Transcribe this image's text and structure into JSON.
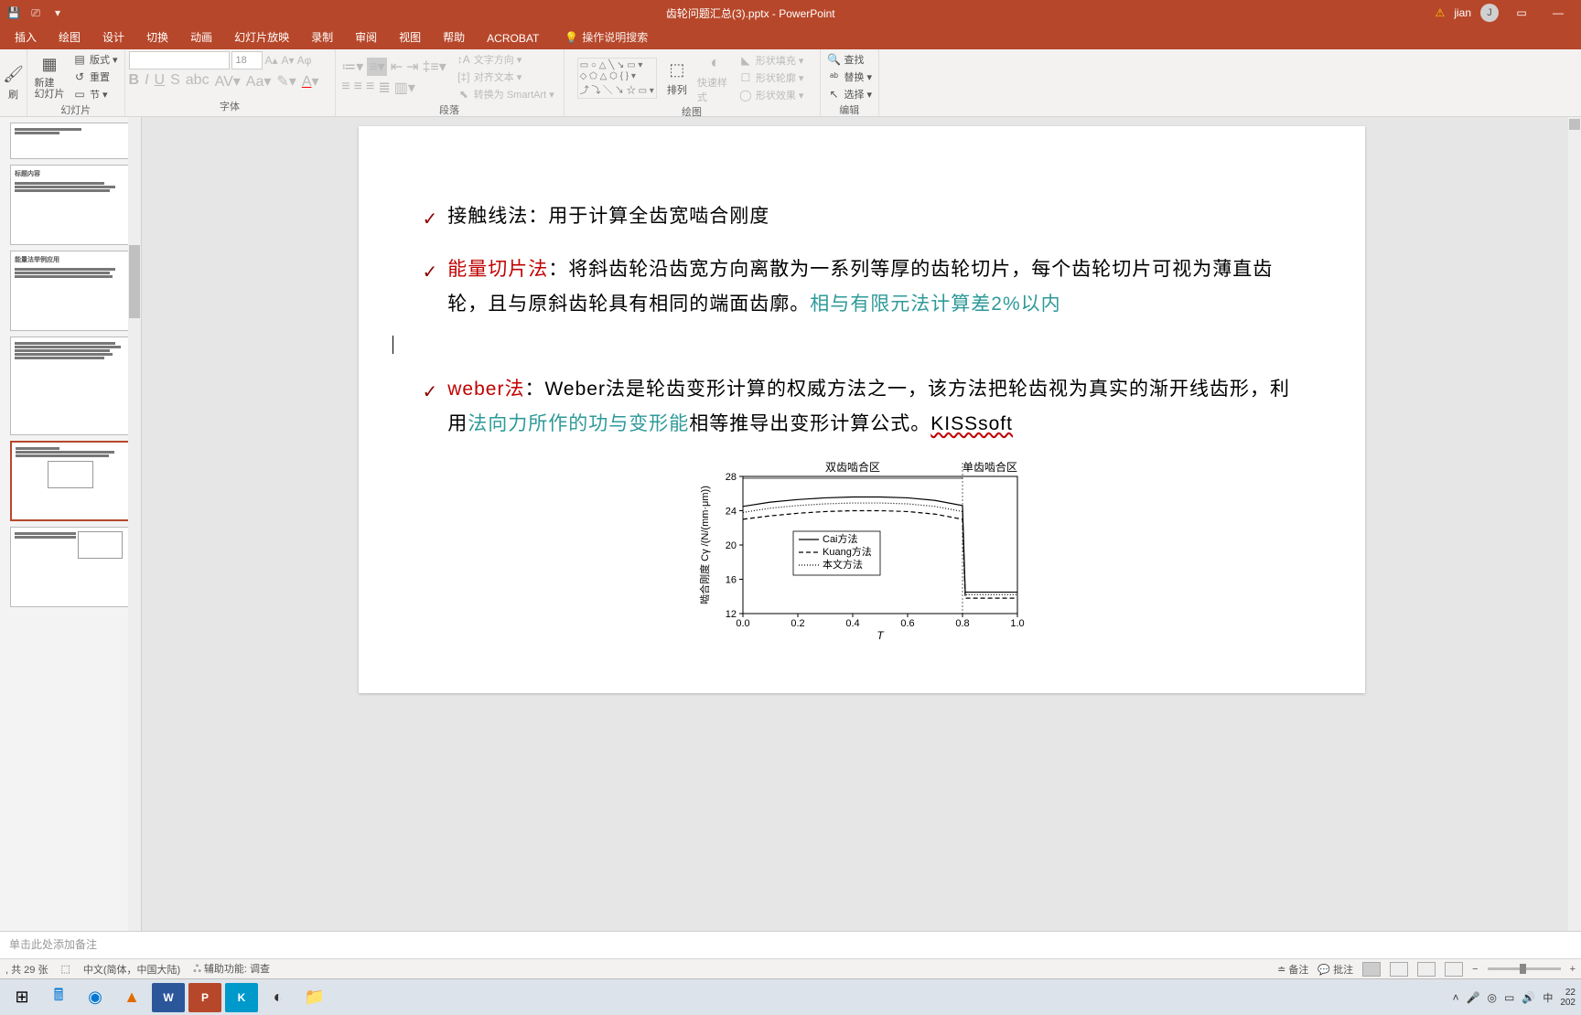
{
  "title_bar": {
    "filename": "齿轮问题汇总(3).pptx - PowerPoint",
    "user_name": "jian",
    "user_initial": "J",
    "warning_icon": "⚠"
  },
  "ribbon_tabs": {
    "insert": "插入",
    "draw": "绘图",
    "design": "设计",
    "transition": "切换",
    "animation": "动画",
    "slideshow": "幻灯片放映",
    "record": "录制",
    "review": "审阅",
    "view": "视图",
    "help": "帮助",
    "acrobat": "ACROBAT",
    "tellme": "操作说明搜索"
  },
  "ribbon": {
    "clipboard": {
      "paste": "刷",
      "label": ""
    },
    "slides": {
      "new_slide": "新建\n幻灯片",
      "layout": "版式",
      "reset": "重置",
      "section": "节",
      "label": "幻灯片"
    },
    "font": {
      "size": "18",
      "label": "字体"
    },
    "paragraph": {
      "text_direction": "文字方向",
      "align_text": "对齐文本",
      "smartart": "转换为 SmartArt",
      "label": "段落"
    },
    "drawing": {
      "arrange": "排列",
      "quick_style": "快速样式",
      "shape_fill": "形状填充",
      "shape_outline": "形状轮廓",
      "shape_effects": "形状效果",
      "label": "绘图"
    },
    "editing": {
      "find": "查找",
      "replace": "替换",
      "select": "选择",
      "label": "编辑"
    }
  },
  "slide_content": {
    "bullet1": {
      "title": "接触线法：",
      "rest": "用于计算全齿宽啮合刚度"
    },
    "bullet2": {
      "title": "能量切片法",
      "colon": "：",
      "part1": "将斜齿轮沿齿宽方向离散为一系列等厚的齿轮切片，每个齿轮切片可视为薄直齿轮，且与原斜齿轮具有相同的端面齿廓。",
      "hl": "相与有限元法计算差2%以内"
    },
    "bullet3": {
      "title": "weber法",
      "colon": "：",
      "part1": "Weber法是轮齿变形计算的权威方法之一，该方法把轮齿视为真实的渐开线齿形，利用",
      "hl1": "法向力所作的功与变形能",
      "part2": "相等推导出变形计算公式。",
      "kiss": "KISSsoft"
    }
  },
  "chart_data": {
    "type": "line",
    "title_top_left": "双齿啮合区",
    "title_top_right": "单齿啮合区",
    "xlabel": "T",
    "ylabel": "啮合刚度 Cγ /(N/(mm·μm))",
    "xticks": [
      0.0,
      0.2,
      0.4,
      0.6,
      0.8,
      1.0
    ],
    "yticks": [
      12,
      16,
      20,
      24,
      28
    ],
    "xlim": [
      0.0,
      1.0
    ],
    "ylim": [
      12,
      28
    ],
    "series": [
      {
        "name": "Cai方法",
        "style": "solid",
        "x": [
          0.0,
          0.1,
          0.2,
          0.3,
          0.4,
          0.5,
          0.6,
          0.7,
          0.8,
          0.81,
          0.9,
          1.0
        ],
        "y": [
          24.5,
          25.0,
          25.3,
          25.5,
          25.6,
          25.6,
          25.5,
          25.2,
          24.6,
          14.5,
          14.5,
          14.5
        ]
      },
      {
        "name": "Kuang方法",
        "style": "dash",
        "x": [
          0.0,
          0.1,
          0.2,
          0.3,
          0.4,
          0.5,
          0.6,
          0.7,
          0.8,
          0.81,
          0.9,
          1.0
        ],
        "y": [
          23.0,
          23.4,
          23.7,
          23.9,
          24.0,
          24.0,
          23.9,
          23.6,
          23.0,
          13.8,
          13.8,
          13.8
        ]
      },
      {
        "name": "本文方法",
        "style": "dot",
        "x": [
          0.0,
          0.1,
          0.2,
          0.3,
          0.4,
          0.5,
          0.6,
          0.7,
          0.8,
          0.81,
          0.9,
          1.0
        ],
        "y": [
          23.8,
          24.3,
          24.6,
          24.8,
          24.9,
          24.9,
          24.8,
          24.5,
          23.9,
          14.2,
          14.2,
          14.2
        ]
      }
    ]
  },
  "notes": {
    "placeholder": "单击此处添加备注"
  },
  "status": {
    "slide_count": ", 共 29 张",
    "lang": "中文(简体，中国大陆)",
    "access": "辅助功能: 调查",
    "notes": "备注",
    "comments": "批注"
  },
  "taskbar": {
    "ime": "中",
    "date": "202",
    "time": "22"
  }
}
